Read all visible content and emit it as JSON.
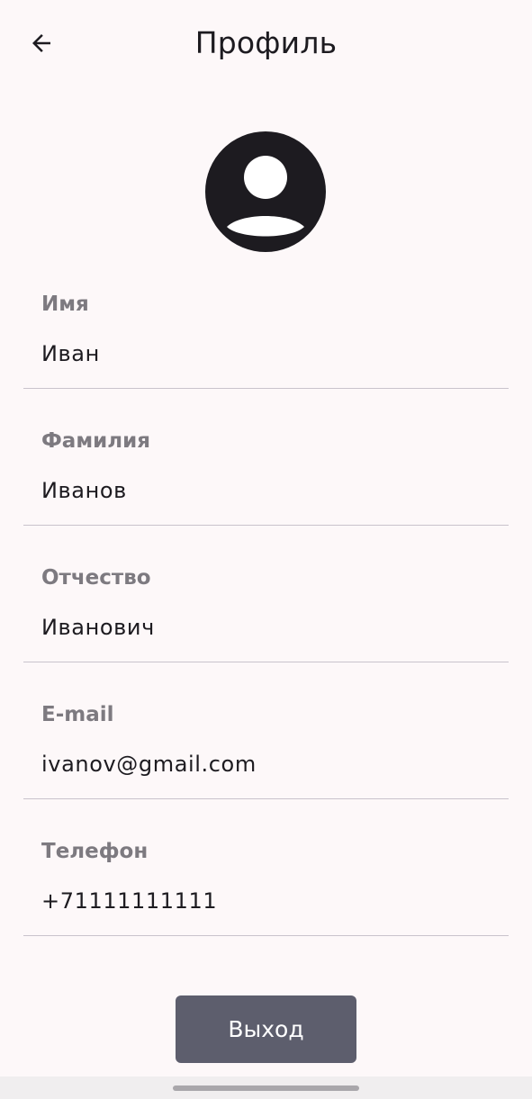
{
  "header": {
    "title": "Профиль",
    "back_icon": "arrow-back-icon"
  },
  "avatar": {
    "icon": "account-circle-icon"
  },
  "fields": [
    {
      "label": "Имя",
      "value": "Иван"
    },
    {
      "label": "Фамилия",
      "value": "Иванов"
    },
    {
      "label": "Отчество",
      "value": "Иванович"
    },
    {
      "label": "E-mail",
      "value": "ivanov@gmail.com"
    },
    {
      "label": "Телефон",
      "value": "+71111111111"
    }
  ],
  "actions": {
    "logout_label": "Выход"
  },
  "colors": {
    "background": "#fdf8f9",
    "button": "#5d5e6d",
    "label": "#7d7a80",
    "divider": "#c9c3cc"
  }
}
